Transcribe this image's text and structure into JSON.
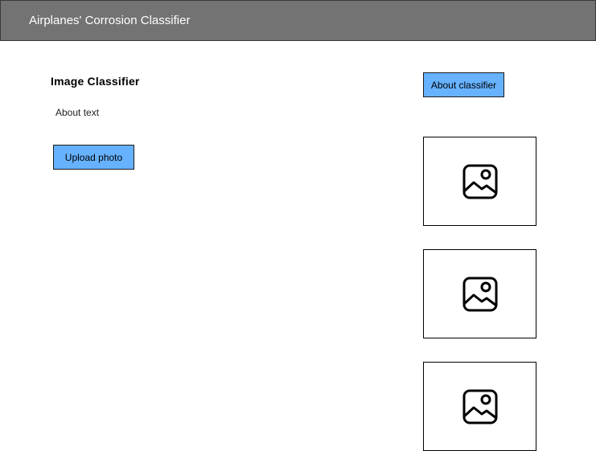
{
  "header": {
    "title": "Airplanes' Corrosion Classifier"
  },
  "main": {
    "title": "Image Classifier",
    "about_text": "About text",
    "upload_label": "Upload photo"
  },
  "sidebar": {
    "about_button_label": "About classifier",
    "image_placeholders": [
      {
        "icon": "image-icon"
      },
      {
        "icon": "image-icon"
      },
      {
        "icon": "image-icon"
      }
    ]
  },
  "colors": {
    "header_bg": "#737373",
    "button_bg": "#66b2ff"
  }
}
